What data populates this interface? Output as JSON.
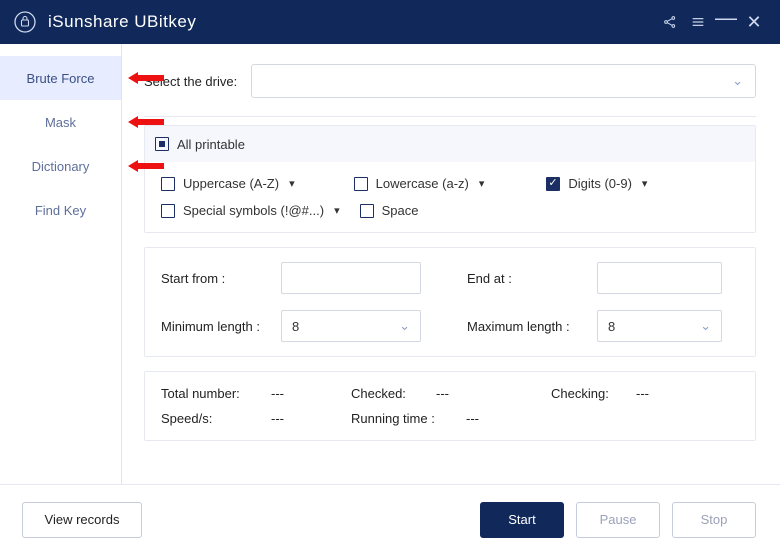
{
  "app": {
    "title": "iSunshare UBitkey"
  },
  "sidebar": {
    "items": [
      {
        "label": "Brute Force",
        "active": true,
        "arrow": true
      },
      {
        "label": "Mask",
        "active": false,
        "arrow": true
      },
      {
        "label": "Dictionary",
        "active": false,
        "arrow": true
      },
      {
        "label": "Find Key",
        "active": false,
        "arrow": false
      }
    ]
  },
  "drive": {
    "label": "Select the drive:",
    "value": ""
  },
  "charset": {
    "all_printable": {
      "label": "All printable",
      "state": "indet"
    },
    "uppercase": {
      "label": "Uppercase (A-Z)",
      "checked": false,
      "dropdown": true
    },
    "lowercase": {
      "label": "Lowercase (a-z)",
      "checked": false,
      "dropdown": true
    },
    "digits": {
      "label": "Digits (0-9)",
      "checked": true,
      "dropdown": true
    },
    "special": {
      "label": "Special symbols (!@#...)",
      "checked": false,
      "dropdown": true
    },
    "space": {
      "label": "Space",
      "checked": false,
      "dropdown": false
    }
  },
  "limits": {
    "start_from": {
      "label": "Start from :",
      "value": ""
    },
    "end_at": {
      "label": "End at :",
      "value": ""
    },
    "min_len": {
      "label": "Minimum length :",
      "value": "8"
    },
    "max_len": {
      "label": "Maximum length :",
      "value": "8"
    }
  },
  "stats": {
    "total": {
      "label": "Total number:",
      "value": "---"
    },
    "checked": {
      "label": "Checked:",
      "value": "---"
    },
    "checking": {
      "label": "Checking:",
      "value": "---"
    },
    "speed": {
      "label": "Speed/s:",
      "value": "---"
    },
    "runtime": {
      "label": "Running time :",
      "value": "---"
    }
  },
  "footer": {
    "view_records": "View records",
    "start": "Start",
    "pause": "Pause",
    "stop": "Stop"
  }
}
